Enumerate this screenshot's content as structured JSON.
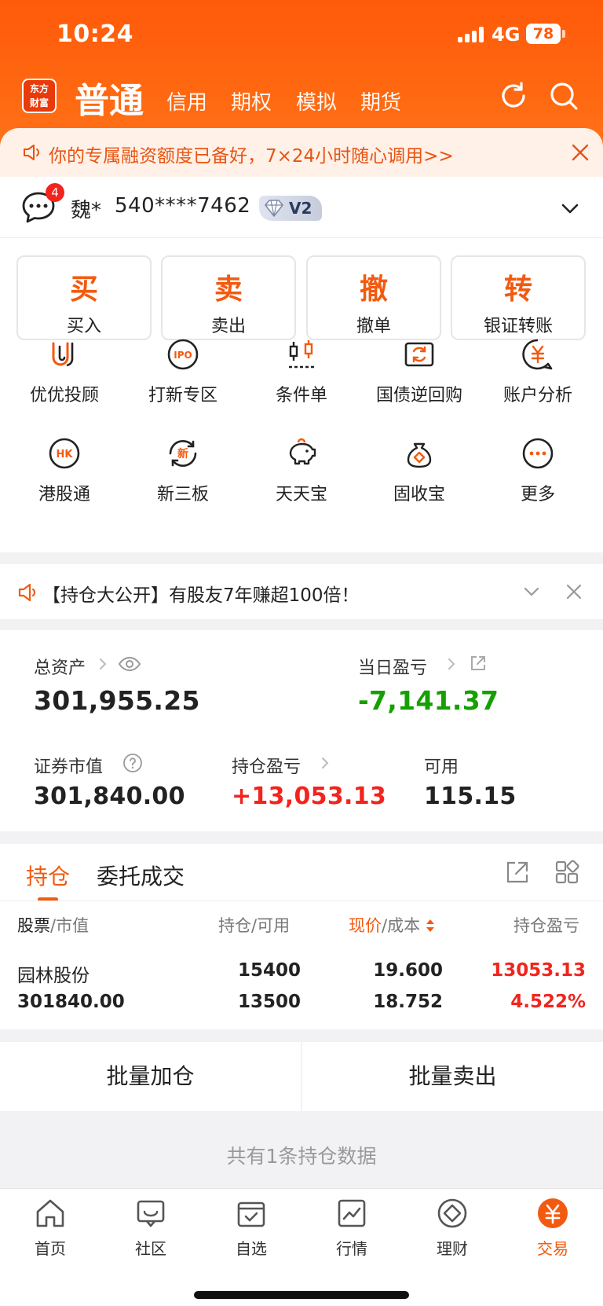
{
  "status_bar": {
    "time": "10:24",
    "network": "4G",
    "battery": "78"
  },
  "brand": {
    "logo_text": "东方财富"
  },
  "top_tabs": {
    "main": "普通",
    "items": [
      "信用",
      "期权",
      "模拟",
      "期货"
    ]
  },
  "banner": {
    "text": "你的专属融资额度已备好，7×24小时随心调用>>"
  },
  "account": {
    "name": "魏*",
    "number": "540****7462",
    "level": "V2",
    "unread": "4"
  },
  "quick_actions": [
    {
      "big": "买",
      "small": "买入"
    },
    {
      "big": "卖",
      "small": "卖出"
    },
    {
      "big": "撤",
      "small": "撤单"
    },
    {
      "big": "转",
      "small": "银证转账"
    }
  ],
  "services": [
    {
      "label": "优优投顾",
      "icon": "youyou-icon"
    },
    {
      "label": "打新专区",
      "icon": "ipo-icon"
    },
    {
      "label": "条件单",
      "icon": "condition-order-icon"
    },
    {
      "label": "国债逆回购",
      "icon": "repo-icon"
    },
    {
      "label": "账户分析",
      "icon": "account-analysis-icon"
    },
    {
      "label": "港股通",
      "icon": "hk-icon"
    },
    {
      "label": "新三板",
      "icon": "neeq-icon"
    },
    {
      "label": "天天宝",
      "icon": "piggy-bank-icon"
    },
    {
      "label": "固收宝",
      "icon": "money-bag-icon"
    },
    {
      "label": "更多",
      "icon": "more-icon"
    }
  ],
  "notice": {
    "text": "【持仓大公开】有股友7年赚超100倍！"
  },
  "assets": {
    "total_label": "总资产",
    "total_value": "301,955.25",
    "daily_pl_label": "当日盈亏",
    "daily_pl_value": "-7,141.37",
    "market_value_label": "证券市值",
    "market_value": "301,840.00",
    "position_pl_label": "持仓盈亏",
    "position_pl_value": "+13,053.13",
    "available_label": "可用",
    "available_value": "115.15"
  },
  "positions": {
    "tabs": [
      "持仓",
      "委托成交"
    ],
    "headers": {
      "col1_a": "股票",
      "col1_b": "市值",
      "col2_a": "持仓",
      "col2_b": "可用",
      "col3_a": "现价",
      "col3_b": "成本",
      "col4": "持仓盈亏"
    },
    "rows": [
      {
        "name": "园林股份",
        "market_value": "301840.00",
        "holding": "15400",
        "available": "13500",
        "price": "19.600",
        "cost": "18.752",
        "pl": "13053.13",
        "pl_pct": "4.522%"
      }
    ]
  },
  "batch": {
    "add": "批量加仓",
    "sell": "批量卖出"
  },
  "summary": "共有1条持仓数据",
  "tabbar": [
    "首页",
    "社区",
    "自选",
    "行情",
    "理财",
    "交易"
  ],
  "colors": {
    "brand": "#ff5a0a",
    "accent": "#f35a10",
    "up": "#f2241d",
    "down": "#16a000"
  }
}
